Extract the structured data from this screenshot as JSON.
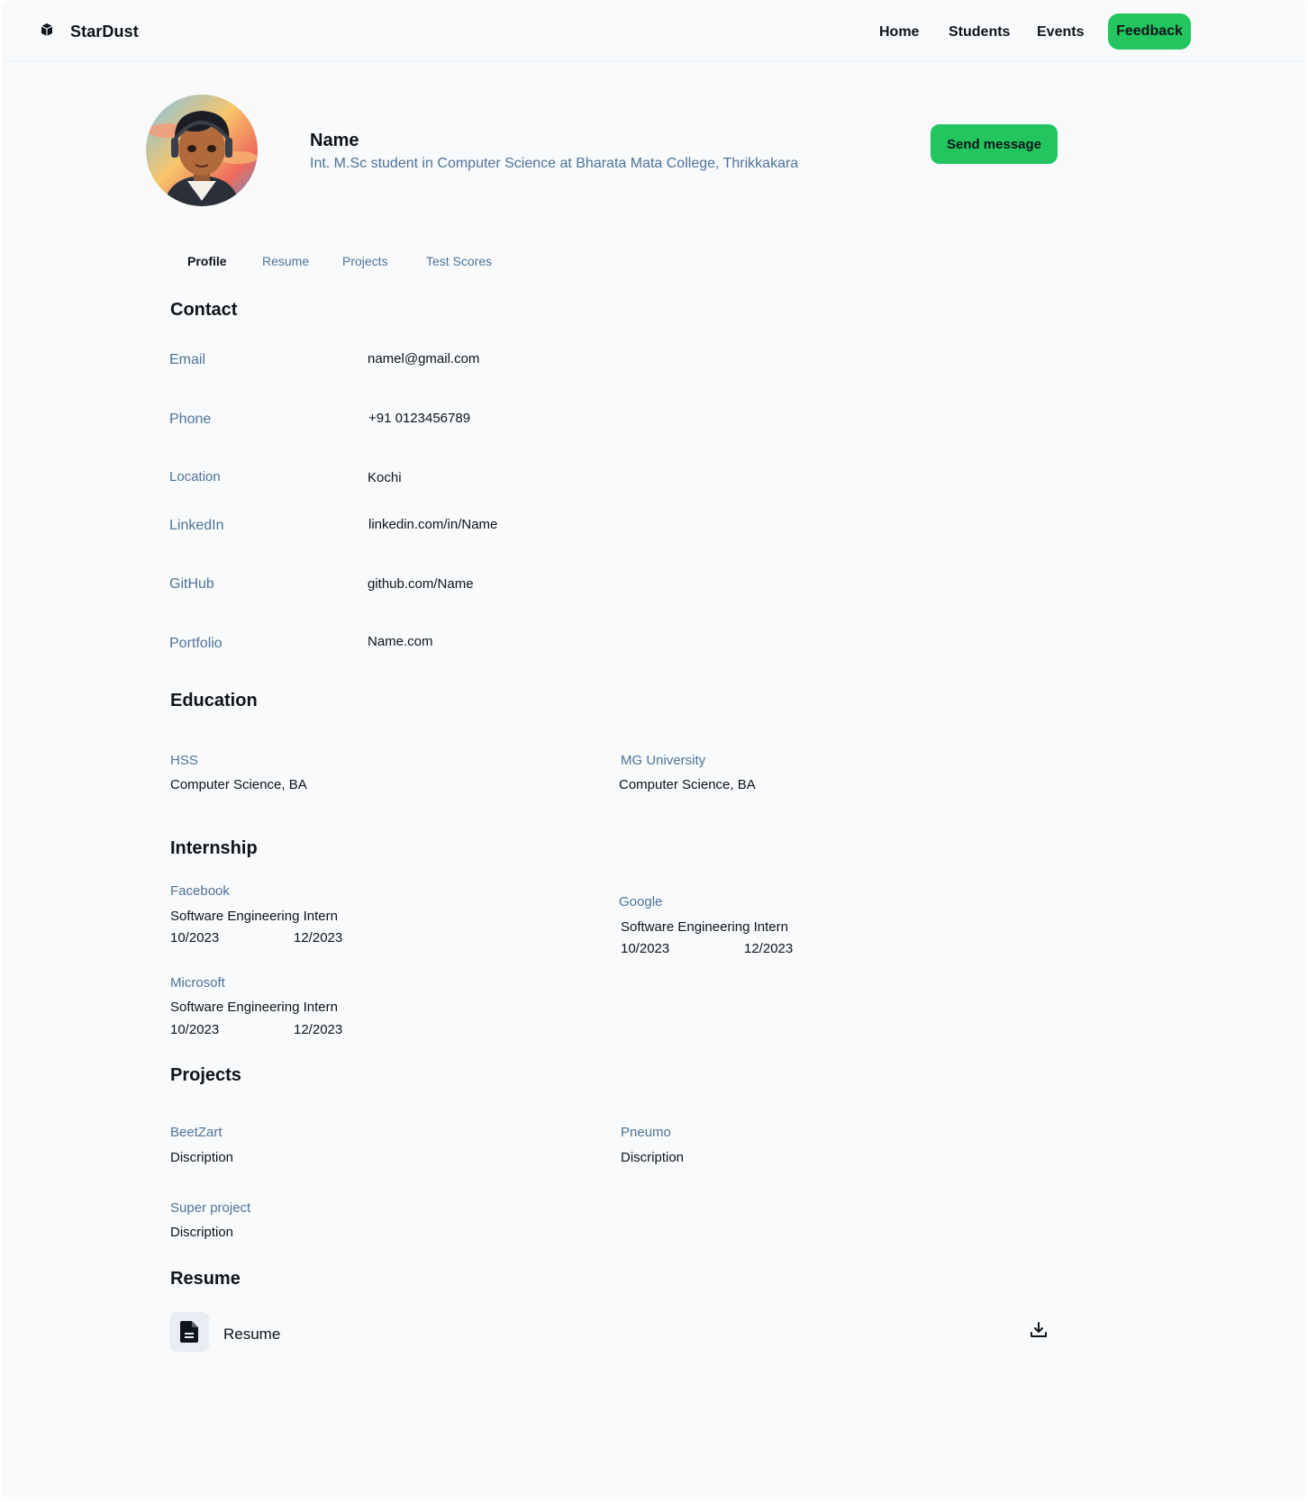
{
  "header": {
    "brand": "StarDust",
    "nav": {
      "home": "Home",
      "students": "Students",
      "events": "Events"
    },
    "feedback_label": "Feedback",
    "logo_icon": "cube-icon"
  },
  "profile": {
    "name": "Name",
    "headline": "Int. M.Sc student in Computer Science at Bharata Mata College, Thrikkakara",
    "send_message_label": "Send message"
  },
  "tabs": [
    "Profile",
    "Resume",
    "Projects",
    "Test Scores"
  ],
  "active_tab": "Profile",
  "contact": {
    "title": "Contact",
    "rows": [
      {
        "label": "Email",
        "value": "namel@gmail.com"
      },
      {
        "label": "Phone",
        "value": "+91 0123456789"
      },
      {
        "label": "Location",
        "value": "Kochi"
      },
      {
        "label": "LinkedIn",
        "value": "linkedin.com/in/Name"
      },
      {
        "label": "GitHub",
        "value": "github.com/Name"
      },
      {
        "label": "Portfolio",
        "value": "Name.com"
      }
    ]
  },
  "education": {
    "title": "Education",
    "items": [
      {
        "school": "HSS",
        "degree": "Computer Science, BA"
      },
      {
        "school": "MG University",
        "degree": "Computer Science, BA"
      }
    ]
  },
  "internship": {
    "title": "Internship",
    "items": [
      {
        "company": "Facebook",
        "role": "Software Engineering Intern",
        "start": "10/2023",
        "end": "12/2023"
      },
      {
        "company": "Google",
        "role": "Software Engineering Intern",
        "start": "10/2023",
        "end": "12/2023"
      },
      {
        "company": "Microsoft",
        "role": "Software Engineering Intern",
        "start": "10/2023",
        "end": "12/2023"
      }
    ]
  },
  "projects": {
    "title": "Projects",
    "items": [
      {
        "name": "BeetZart",
        "description": "Discription"
      },
      {
        "name": "Pneumo",
        "description": "Discription"
      },
      {
        "name": "Super project",
        "description": "Discription"
      }
    ]
  },
  "resume": {
    "title": "Resume",
    "file_label": "Resume",
    "file_icon": "document-icon",
    "download_icon": "download-icon"
  },
  "colors": {
    "accent": "#22c55e",
    "muted_text": "#4e7397",
    "text": "#0e141b",
    "background": "#f8fafc"
  }
}
